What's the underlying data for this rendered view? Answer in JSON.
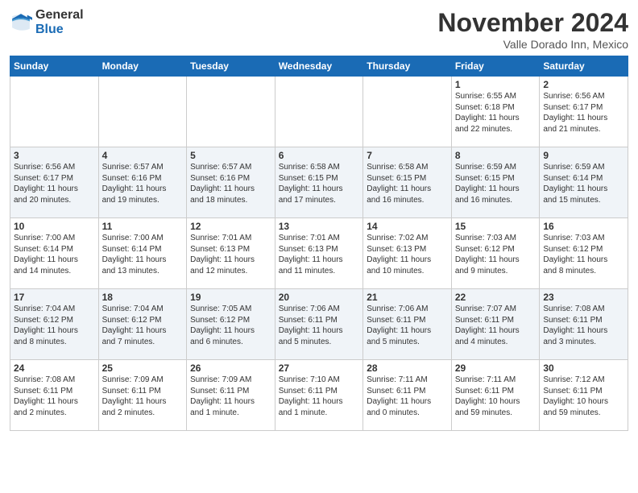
{
  "header": {
    "logo_general": "General",
    "logo_blue": "Blue",
    "month_title": "November 2024",
    "subtitle": "Valle Dorado Inn, Mexico"
  },
  "weekdays": [
    "Sunday",
    "Monday",
    "Tuesday",
    "Wednesday",
    "Thursday",
    "Friday",
    "Saturday"
  ],
  "weeks": [
    [
      {
        "day": "",
        "info": ""
      },
      {
        "day": "",
        "info": ""
      },
      {
        "day": "",
        "info": ""
      },
      {
        "day": "",
        "info": ""
      },
      {
        "day": "",
        "info": ""
      },
      {
        "day": "1",
        "info": "Sunrise: 6:55 AM\nSunset: 6:18 PM\nDaylight: 11 hours\nand 22 minutes."
      },
      {
        "day": "2",
        "info": "Sunrise: 6:56 AM\nSunset: 6:17 PM\nDaylight: 11 hours\nand 21 minutes."
      }
    ],
    [
      {
        "day": "3",
        "info": "Sunrise: 6:56 AM\nSunset: 6:17 PM\nDaylight: 11 hours\nand 20 minutes."
      },
      {
        "day": "4",
        "info": "Sunrise: 6:57 AM\nSunset: 6:16 PM\nDaylight: 11 hours\nand 19 minutes."
      },
      {
        "day": "5",
        "info": "Sunrise: 6:57 AM\nSunset: 6:16 PM\nDaylight: 11 hours\nand 18 minutes."
      },
      {
        "day": "6",
        "info": "Sunrise: 6:58 AM\nSunset: 6:15 PM\nDaylight: 11 hours\nand 17 minutes."
      },
      {
        "day": "7",
        "info": "Sunrise: 6:58 AM\nSunset: 6:15 PM\nDaylight: 11 hours\nand 16 minutes."
      },
      {
        "day": "8",
        "info": "Sunrise: 6:59 AM\nSunset: 6:15 PM\nDaylight: 11 hours\nand 16 minutes."
      },
      {
        "day": "9",
        "info": "Sunrise: 6:59 AM\nSunset: 6:14 PM\nDaylight: 11 hours\nand 15 minutes."
      }
    ],
    [
      {
        "day": "10",
        "info": "Sunrise: 7:00 AM\nSunset: 6:14 PM\nDaylight: 11 hours\nand 14 minutes."
      },
      {
        "day": "11",
        "info": "Sunrise: 7:00 AM\nSunset: 6:14 PM\nDaylight: 11 hours\nand 13 minutes."
      },
      {
        "day": "12",
        "info": "Sunrise: 7:01 AM\nSunset: 6:13 PM\nDaylight: 11 hours\nand 12 minutes."
      },
      {
        "day": "13",
        "info": "Sunrise: 7:01 AM\nSunset: 6:13 PM\nDaylight: 11 hours\nand 11 minutes."
      },
      {
        "day": "14",
        "info": "Sunrise: 7:02 AM\nSunset: 6:13 PM\nDaylight: 11 hours\nand 10 minutes."
      },
      {
        "day": "15",
        "info": "Sunrise: 7:03 AM\nSunset: 6:12 PM\nDaylight: 11 hours\nand 9 minutes."
      },
      {
        "day": "16",
        "info": "Sunrise: 7:03 AM\nSunset: 6:12 PM\nDaylight: 11 hours\nand 8 minutes."
      }
    ],
    [
      {
        "day": "17",
        "info": "Sunrise: 7:04 AM\nSunset: 6:12 PM\nDaylight: 11 hours\nand 8 minutes."
      },
      {
        "day": "18",
        "info": "Sunrise: 7:04 AM\nSunset: 6:12 PM\nDaylight: 11 hours\nand 7 minutes."
      },
      {
        "day": "19",
        "info": "Sunrise: 7:05 AM\nSunset: 6:12 PM\nDaylight: 11 hours\nand 6 minutes."
      },
      {
        "day": "20",
        "info": "Sunrise: 7:06 AM\nSunset: 6:11 PM\nDaylight: 11 hours\nand 5 minutes."
      },
      {
        "day": "21",
        "info": "Sunrise: 7:06 AM\nSunset: 6:11 PM\nDaylight: 11 hours\nand 5 minutes."
      },
      {
        "day": "22",
        "info": "Sunrise: 7:07 AM\nSunset: 6:11 PM\nDaylight: 11 hours\nand 4 minutes."
      },
      {
        "day": "23",
        "info": "Sunrise: 7:08 AM\nSunset: 6:11 PM\nDaylight: 11 hours\nand 3 minutes."
      }
    ],
    [
      {
        "day": "24",
        "info": "Sunrise: 7:08 AM\nSunset: 6:11 PM\nDaylight: 11 hours\nand 2 minutes."
      },
      {
        "day": "25",
        "info": "Sunrise: 7:09 AM\nSunset: 6:11 PM\nDaylight: 11 hours\nand 2 minutes."
      },
      {
        "day": "26",
        "info": "Sunrise: 7:09 AM\nSunset: 6:11 PM\nDaylight: 11 hours\nand 1 minute."
      },
      {
        "day": "27",
        "info": "Sunrise: 7:10 AM\nSunset: 6:11 PM\nDaylight: 11 hours\nand 1 minute."
      },
      {
        "day": "28",
        "info": "Sunrise: 7:11 AM\nSunset: 6:11 PM\nDaylight: 11 hours\nand 0 minutes."
      },
      {
        "day": "29",
        "info": "Sunrise: 7:11 AM\nSunset: 6:11 PM\nDaylight: 10 hours\nand 59 minutes."
      },
      {
        "day": "30",
        "info": "Sunrise: 7:12 AM\nSunset: 6:11 PM\nDaylight: 10 hours\nand 59 minutes."
      }
    ]
  ]
}
